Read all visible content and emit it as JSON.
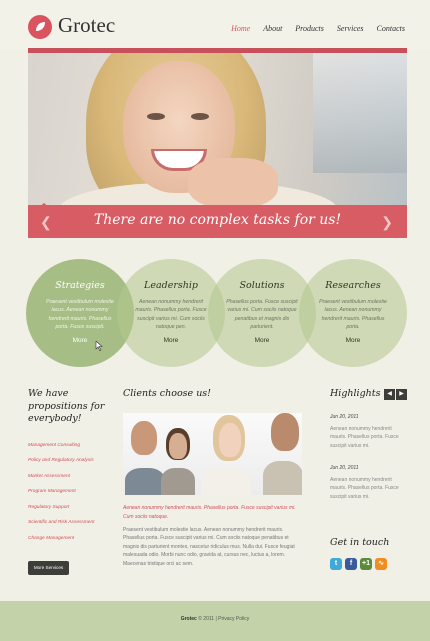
{
  "header": {
    "logo": "Grotec",
    "nav": [
      "Home",
      "About",
      "Products",
      "Services",
      "Contacts"
    ]
  },
  "hero": {
    "caption": "There are no complex tasks for us!"
  },
  "features": [
    {
      "title": "Strategies",
      "text": "Praesent vestibulum molestie lacus. Aenean nonummy hendrerit mauris. Phasellus porta. Fusce suscipit.",
      "more": "More"
    },
    {
      "title": "Leadership",
      "text": "Aenean nonummy hendrerit mauris. Phasellus porta. Fusce suscipit varius mi. Cum sociis natoque pen.",
      "more": "More"
    },
    {
      "title": "Solutions",
      "text": "Phasellus porta. Fusce suscipit varius mi. Cum sociis natoque penatibus et magnis dis parturient.",
      "more": "More"
    },
    {
      "title": "Researches",
      "text": "Praesent vestibulum molestie lacus. Aenean nonummy hendrerit mauris. Phasellus porta.",
      "more": "More"
    }
  ],
  "left": {
    "heading_line1": "We have",
    "heading_line2": "propositions for",
    "heading_line3": "everybody!",
    "links": [
      "Management Consulting",
      "Policy and Regulatory Analysis",
      "Market Assessment",
      "Program Management",
      "Regulatory Support",
      "Scientific and Risk Assessment",
      "Change Management"
    ],
    "button": "More Services"
  },
  "middle": {
    "heading": "Clients choose us!",
    "red_text": "Aenean nonummy hendrerit mauris. Phasellus porta. Fusce suscipit varius mi. Cum sociis natoque.",
    "body": "Praesent vestibulum molestie lacus. Aenean nonummy hendrerit mauris. Phasellus porta. Fusce suscipit varius mi. Cum sociis natoque penatibus et magnis dis parturient montes, nascetur ridiculus mus. Nulla dui. Fusce feugiat malesuada odio. Morbi nunc odio, gravida at, cursus nec, luctus a, lorem. Maecenas tristique orci ac sem."
  },
  "right": {
    "heading": "Highlights",
    "items": [
      {
        "date": "Jun 20, 2011",
        "text": "Aenean nonummy hendrerit mauris. Phasellus porta. Fusce suscipit varius mi."
      },
      {
        "date": "Jun 20, 2011",
        "text": "Aenean nonummy hendrerit mauris. Phasellus porta. Fusce suscipit varius mi."
      }
    ],
    "get_in_touch": "Get in touch",
    "social": [
      "twitter-icon",
      "facebook-icon",
      "google-plus-icon",
      "rss-icon"
    ]
  },
  "footer": {
    "brand": "Grotec",
    "copyright": "© 2011",
    "separator": "|",
    "privacy": "Privacy Policy"
  },
  "colors": {
    "accent": "#d9545f",
    "green": "#a6be86",
    "footer": "#c3d2a8",
    "background": "#f1f0e6"
  }
}
